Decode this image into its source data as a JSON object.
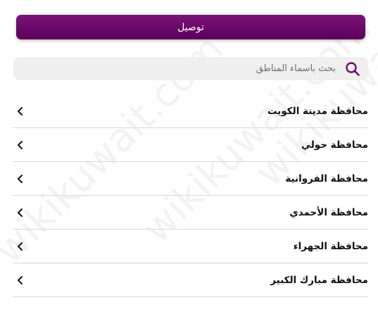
{
  "header": {
    "delivery_label": "توصيل"
  },
  "search": {
    "placeholder": "بحث بأسماء المناطق",
    "icon": "search-icon"
  },
  "governorates": [
    {
      "label": "محافظة مدينة الكويت"
    },
    {
      "label": "محافظة حولي"
    },
    {
      "label": "محافظة الفروانية"
    },
    {
      "label": "محافظة الأحمدي"
    },
    {
      "label": "محافظة الجهراء"
    },
    {
      "label": "محافظة مبارك الكبير"
    }
  ],
  "watermark": {
    "text": "wikikuwait.com"
  },
  "colors": {
    "accent": "#6f0a6f",
    "accent_dark": "#5b005b",
    "divider": "#d9d9d9",
    "search_bg": "#efefef"
  }
}
